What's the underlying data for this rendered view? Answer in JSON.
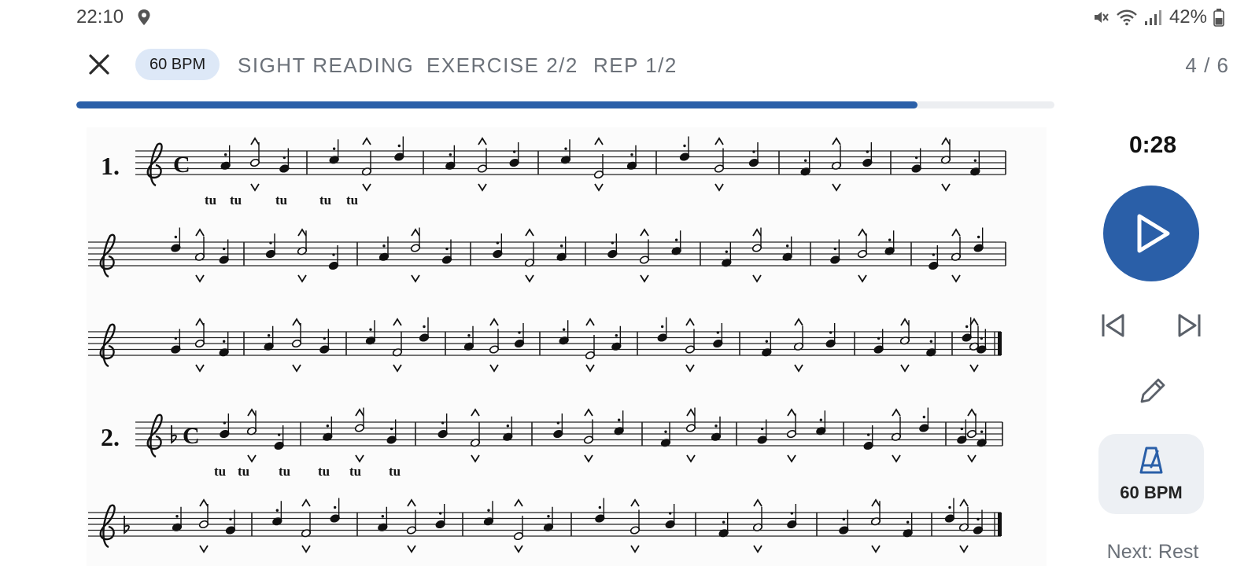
{
  "status_bar": {
    "time": "22:10",
    "battery": "42%"
  },
  "header": {
    "bpm_chip": "60 BPM",
    "mode": "SIGHT READING",
    "exercise": "EXERCISE 2/2",
    "rep": "REP 1/2",
    "page_count": "4 / 6"
  },
  "progress": {
    "value_percent": 86
  },
  "sheet": {
    "exercise_numbers": [
      "1.",
      "2."
    ],
    "syllable": "tu",
    "syllable_rows": [
      {
        "system": 0,
        "count": 5
      },
      {
        "system": 3,
        "count": 6
      }
    ]
  },
  "panel": {
    "timer": "0:28",
    "metronome_bpm": "60 BPM",
    "next": "Next: Rest"
  },
  "colors": {
    "accent": "#2a5fa8",
    "chip_bg": "#dde8f7",
    "muted_text": "#6b7179"
  },
  "icons": {
    "close": "close-icon",
    "play": "play-icon",
    "previous": "skip-previous-icon",
    "next": "skip-next-icon",
    "edit": "pencil-icon",
    "metronome": "metronome-icon"
  }
}
